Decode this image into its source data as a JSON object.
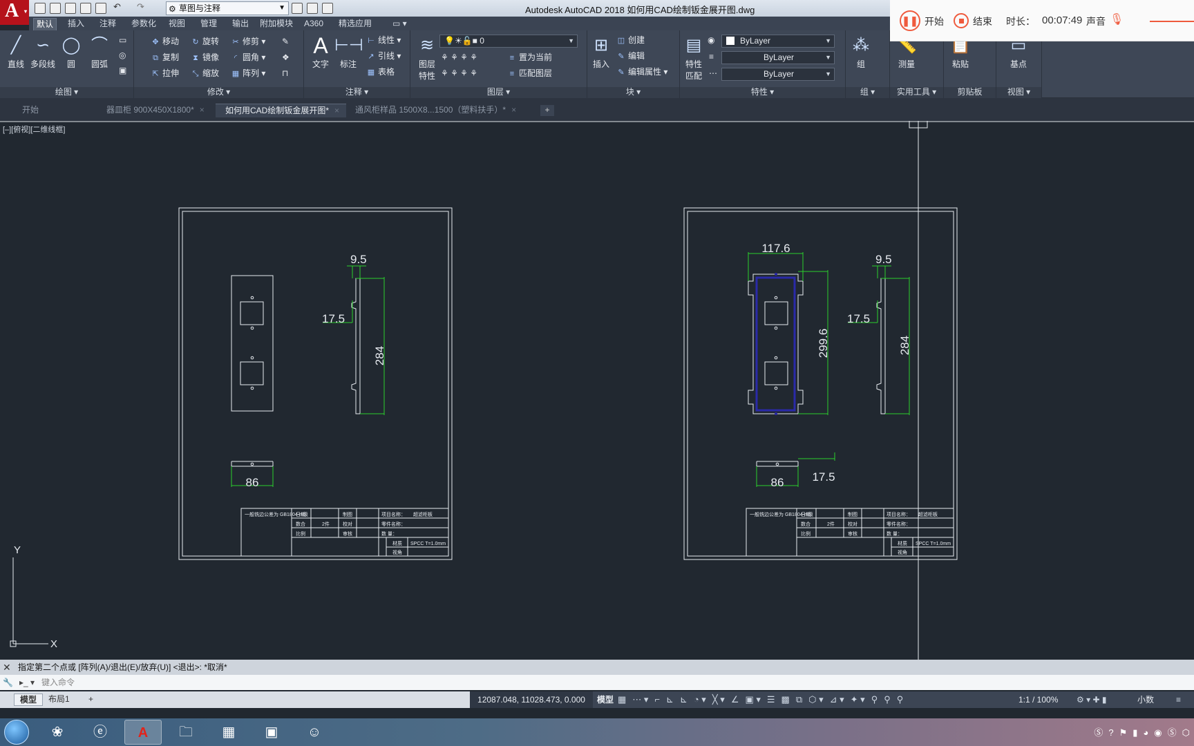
{
  "titlebar": {
    "workspace": "草图与注释",
    "window_title": "Autodesk AutoCAD 2018    如何用CAD绘制钣金展开图.dwg"
  },
  "ribbon_tabs": [
    "默认",
    "插入",
    "注释",
    "参数化",
    "视图",
    "管理",
    "输出",
    "附加模块",
    "A360",
    "精选应用"
  ],
  "ribbon": {
    "draw": {
      "line": "直线",
      "polyline": "多段线",
      "circle": "圆",
      "arc": "圆弧",
      "footer": "绘图 ▾"
    },
    "modify": {
      "move": "移动",
      "rotate": "旋转",
      "trim": "修剪",
      "copy": "复制",
      "mirror": "镜像",
      "fillet": "圆角",
      "stretch": "拉伸",
      "scale": "缩放",
      "array": "阵列",
      "footer": "修改 ▾"
    },
    "annotation": {
      "text": "文字",
      "dimension": "标注",
      "linear": "线性",
      "leader": "引线",
      "table": "表格",
      "footer": "注释 ▾"
    },
    "layers": {
      "layer_props_1": "图层",
      "layer_props_2": "特性",
      "current_layer": "0",
      "make_current": "置为当前",
      "match_layer": "匹配图层",
      "footer": "图层 ▾"
    },
    "block": {
      "insert": "插入",
      "create": "创建",
      "edit": "编辑",
      "edit_attr": "编辑属性",
      "footer": "块 ▾"
    },
    "properties": {
      "match_1": "特性",
      "match_2": "匹配",
      "color": "ByLayer",
      "linetype": "ByLayer",
      "lineweight": "ByLayer",
      "footer": "特性 ▾"
    },
    "groups": {
      "group": "组",
      "footer": "组 ▾"
    },
    "utilities": {
      "measure": "测量",
      "footer": "实用工具 ▾"
    },
    "clipboard": {
      "paste": "粘贴",
      "footer": "剪贴板"
    },
    "view": {
      "base": "基点",
      "footer": "视图 ▾"
    }
  },
  "recorder": {
    "start": "开始",
    "stop": "结束",
    "duration_label": "时长：",
    "duration": "00:07:49",
    "sound": "声音"
  },
  "file_tabs": [
    {
      "label": "开始"
    },
    {
      "label": "器皿柜 900X450X1800*"
    },
    {
      "label": "如何用CAD绘制钣金展开图*"
    },
    {
      "label": "通风柜样品  1500X8...1500（塑料扶手）*"
    }
  ],
  "viewport_label": "[–][俯视][二维线框]",
  "drawing": {
    "left_sheet": {
      "dim_top": "9.5",
      "dim_side": "17.5",
      "dim_height": "284",
      "dim_width": "86"
    },
    "right_sheet": {
      "dim_panel_width": "117.6",
      "dim_panel_height": "299.6",
      "dim_top": "9.5",
      "dim_side": "17.5",
      "dim_height": "284",
      "dim_width": "86",
      "dim_offset": "17.5"
    },
    "title_block": {
      "company": "一般铣边公差为 GB1804-m级",
      "date": "日期",
      "drawn": "制图",
      "project_label": "项目名称：",
      "project": "超滤柜板",
      "qty_label": "数合",
      "qty": "2件",
      "check": "校对",
      "part_label": "零件名称：",
      "scale": "比例",
      "review": "审核",
      "count_label": "数  量：",
      "material_label": "材质",
      "material": "SPCC T=1.0mm",
      "view_label": "视角"
    }
  },
  "ucs": {
    "x": "X",
    "y": "Y"
  },
  "command": {
    "history": "指定第二个点或 [阵列(A)/退出(E)/放弃(U)] <退出>: *取消*",
    "placeholder": "键入命令"
  },
  "layout_tabs": [
    "模型",
    "布局1"
  ],
  "status": {
    "coords": "12087.048, 11028.473, 0.000",
    "model": "模型",
    "scale": "1:1 / 100%",
    "units": "小数"
  }
}
